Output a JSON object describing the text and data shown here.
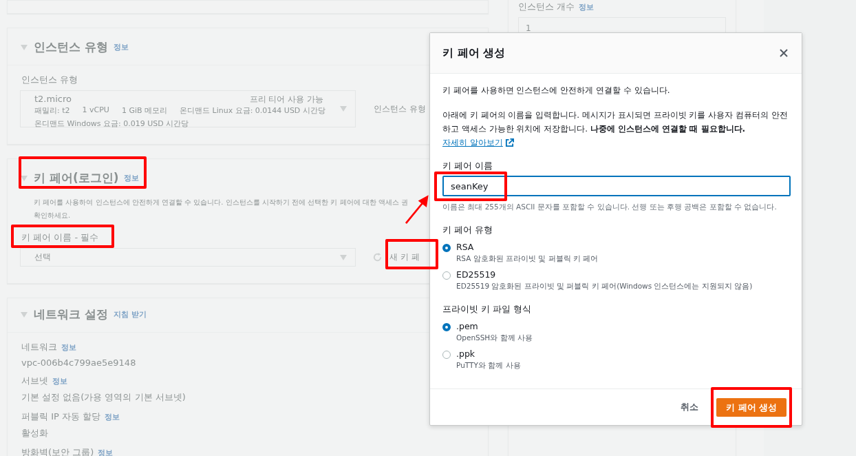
{
  "background": {
    "instance_type": {
      "title": "인스턴스 유형",
      "info": "정보",
      "label": "인스턴스 유형",
      "selected_type": "t2.micro",
      "badge": "프리 티어 사용 가능",
      "specs": [
        "패밀리: t2",
        "1 vCPU",
        "1 GiB 메모리",
        "온디맨드 Linux 요금: 0.0144 USD 시간당"
      ],
      "windows_price": "온디맨드 Windows 요금: 0.019 USD 시간당",
      "compare_link": "인스턴스 유형"
    },
    "key_pair": {
      "title": "키 페어(로그인)",
      "info": "정보",
      "description": "키 페어를 사용하여 인스턴스에 안전하게 연결할 수 있습니다. 인스턴스를 시작하기 전에 선택한 키 페어에 대한 액세스 권",
      "description_2": "확인하세요.",
      "label": "키 페어 이름 - 필수",
      "placeholder": "선택",
      "new_button": "새 키 페"
    },
    "network": {
      "title": "네트워크 설정",
      "guide": "지침 받기",
      "fields": [
        {
          "label": "네트워크",
          "info": "정보",
          "value": "vpc-006b4c799ae5e9148"
        },
        {
          "label": "서브넷",
          "info": "정보",
          "value": "기본 설정 없음(가용 영역의 기본 서브넷)"
        },
        {
          "label": "퍼블릭 IP 자동 할당",
          "info": "정보",
          "value": "활성화"
        },
        {
          "label": "방화벽(보안 그룹)",
          "info": "정보"
        }
      ]
    },
    "instance_count": {
      "label": "인스턴스 개수",
      "info": "정보",
      "value": "1"
    }
  },
  "modal": {
    "title": "키 페어 생성",
    "intro": "키 페어를 사용하면 인스턴스에 안전하게 연결할 수 있습니다.",
    "paragraph": "아래에 키 페어의 이름을 입력합니다. 메시지가 표시되면 프라이빗 키를 사용자 컴퓨터의 안전하고 액세스 가능한 위치에 저장합니다. **나중에 인스턴스에 연결할 때 필요합니다.**",
    "learn_more": "자세히 알아보기",
    "name_field": {
      "label": "키 페어 이름",
      "value": "seanKey",
      "hint": "이름은 최대 255개의 ASCII 문자를 포함할 수 있습니다. 선행 또는 후행 공백은 포함할 수 없습니다."
    },
    "groups": [
      {
        "title": "키 페어 유형",
        "options": [
          {
            "label": "RSA",
            "description": "RSA 암호화된 프라이빗 및 퍼블릭 키 페어",
            "selected": true
          },
          {
            "label": "ED25519",
            "description": "ED25519 암호화된 프라이빗 및 퍼블릭 키 페어(Windows 인스턴스에는 지원되지 않음)",
            "selected": false
          }
        ]
      },
      {
        "title": "프라이빗 키 파일 형식",
        "options": [
          {
            "label": ".pem",
            "description": "OpenSSH와 함께 사용",
            "selected": true
          },
          {
            "label": ".ppk",
            "description": "PuTTY와 함께 사용",
            "selected": false
          }
        ]
      }
    ],
    "cancel": "취소",
    "submit": "키 페어 생성"
  }
}
